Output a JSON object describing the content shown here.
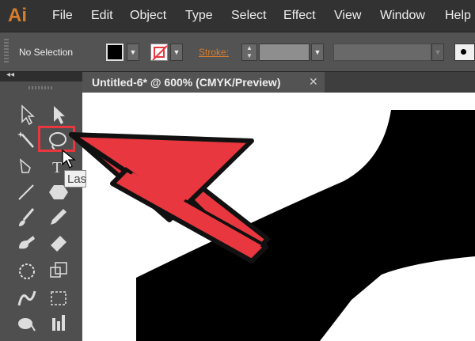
{
  "app": {
    "logo": "Ai"
  },
  "menu": [
    "File",
    "Edit",
    "Object",
    "Type",
    "Select",
    "Effect",
    "View",
    "Window",
    "Help"
  ],
  "control_bar": {
    "selection": "No Selection",
    "stroke_label": "Stroke:"
  },
  "panel": {
    "collapse": "◂◂"
  },
  "document": {
    "tab_title": "Untitled-6* @ 600% (CMYK/Preview)",
    "close": "✕"
  },
  "tooltip": {
    "text": "Lasso"
  },
  "colors": {
    "accent": "#d87d2b",
    "highlight": "#e8373f",
    "arrow_outline": "#111111"
  },
  "icons": [
    "selection-tool-icon",
    "direct-selection-tool-icon",
    "magic-wand-tool-icon",
    "lasso-tool-icon",
    "pen-tool-icon",
    "type-tool-icon",
    "line-segment-tool-icon",
    "shape-tool-icon",
    "paintbrush-tool-icon",
    "pencil-tool-icon",
    "blob-brush-tool-icon",
    "eraser-tool-icon",
    "rotate-tool-icon",
    "scale-tool-icon",
    "warp-tool-icon",
    "free-transform-tool-icon",
    "shape-builder-tool-icon",
    "graph-tool-icon"
  ]
}
